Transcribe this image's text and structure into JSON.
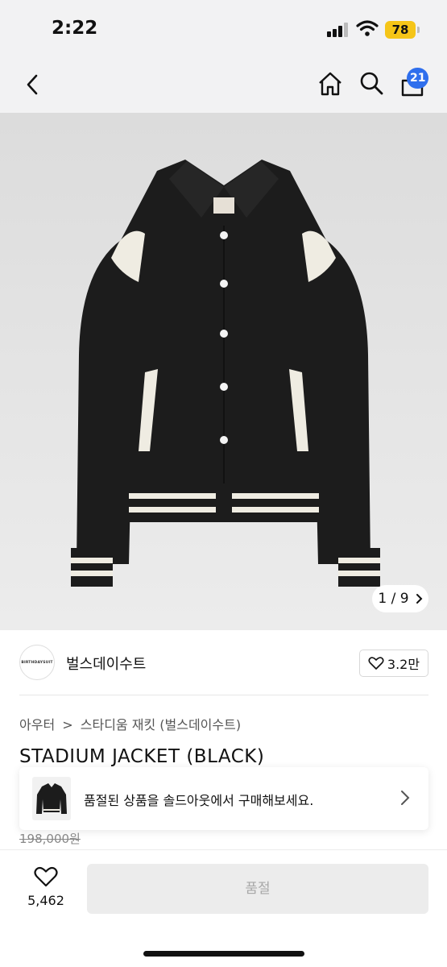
{
  "status_bar": {
    "time": "2:22",
    "battery": "78"
  },
  "nav": {
    "cart_count": "21"
  },
  "gallery": {
    "pager": "1 / 9"
  },
  "brand": {
    "logo_text": "BIRTHDAYSUIT",
    "name": "벌스데이수트",
    "likes": "3.2만"
  },
  "breadcrumb": [
    "아우터",
    ">",
    "스타디움 재킷 (벌스데이수트)"
  ],
  "product": {
    "title": "STADIUM JACKET (BLACK)",
    "original_price": "198,000원"
  },
  "soldout_banner": {
    "text": "품절된 상품을 솔드아웃에서 구매해보세요."
  },
  "bottom_bar": {
    "wish_count": "5,462",
    "buy_label": "품절"
  },
  "colors": {
    "accent_badge": "#2f6fed",
    "battery": "#f5c518",
    "header_bg": "#f2f2f3",
    "jacket": "#1c1c1c",
    "trim": "#efece2"
  }
}
